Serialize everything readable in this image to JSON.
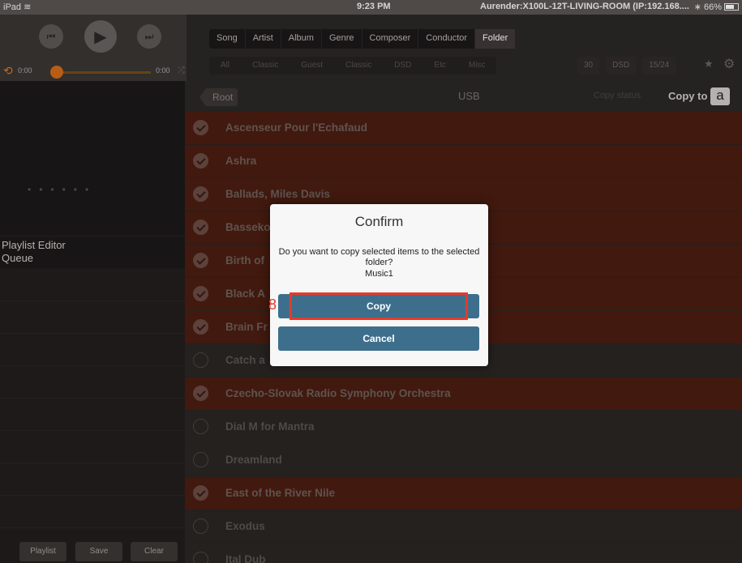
{
  "status_bar": {
    "device": "iPad",
    "time": "9:23 PM",
    "connection": "Aurender:X100L-12T-LIVING-ROOM (IP:192.168....",
    "battery": "66%"
  },
  "player": {
    "elapsed": "0:00",
    "total": "0:00",
    "progress": 0
  },
  "browse_tabs": [
    "Song",
    "Artist",
    "Album",
    "Genre",
    "Composer",
    "Conductor",
    "Folder"
  ],
  "active_tab": "Folder",
  "genre_tabs": [
    "All",
    "Classic",
    "Guest",
    "Classic",
    "DSD",
    "Etc",
    "Misc"
  ],
  "filters": [
    "30",
    "DSD",
    "15/24"
  ],
  "left_panel": {
    "playlist_editor": "Playlist Editor",
    "queue": "Queue",
    "buttons": {
      "playlist": "Playlist",
      "save": "Save",
      "clear": "Clear"
    }
  },
  "list": {
    "root_label": "Root",
    "title": "USB",
    "copy_status": "Copy status",
    "copy_to": "Copy to",
    "badge": "a",
    "items": [
      {
        "name": "Ascenseur Pour l'Echafaud",
        "selected": true
      },
      {
        "name": "Ashra",
        "selected": true
      },
      {
        "name": "Ballads, Miles Davis",
        "selected": true
      },
      {
        "name": "Basseko",
        "selected": true
      },
      {
        "name": "Birth of",
        "selected": true
      },
      {
        "name": "Black A",
        "selected": true
      },
      {
        "name": "Brain Fr",
        "selected": true
      },
      {
        "name": "Catch a",
        "selected": false
      },
      {
        "name": "Czecho-Slovak Radio Symphony Orchestra",
        "selected": true
      },
      {
        "name": "Dial M for Mantra",
        "selected": false
      },
      {
        "name": "Dreamland",
        "selected": false
      },
      {
        "name": "East of the River Nile",
        "selected": true
      },
      {
        "name": "Exodus",
        "selected": false
      },
      {
        "name": "Ital Dub",
        "selected": false
      }
    ]
  },
  "dialog": {
    "title": "Confirm",
    "message": "Do you want to copy selected items to the selected folder?",
    "folder": "Music1",
    "copy_label": "Copy",
    "cancel_label": "Cancel"
  },
  "annotation": {
    "step": "8"
  },
  "colors": {
    "accent": "#d26a18",
    "selected_row": "#4a1d11",
    "dialog_button": "#3d6f8d",
    "highlight": "#e53a2a"
  }
}
